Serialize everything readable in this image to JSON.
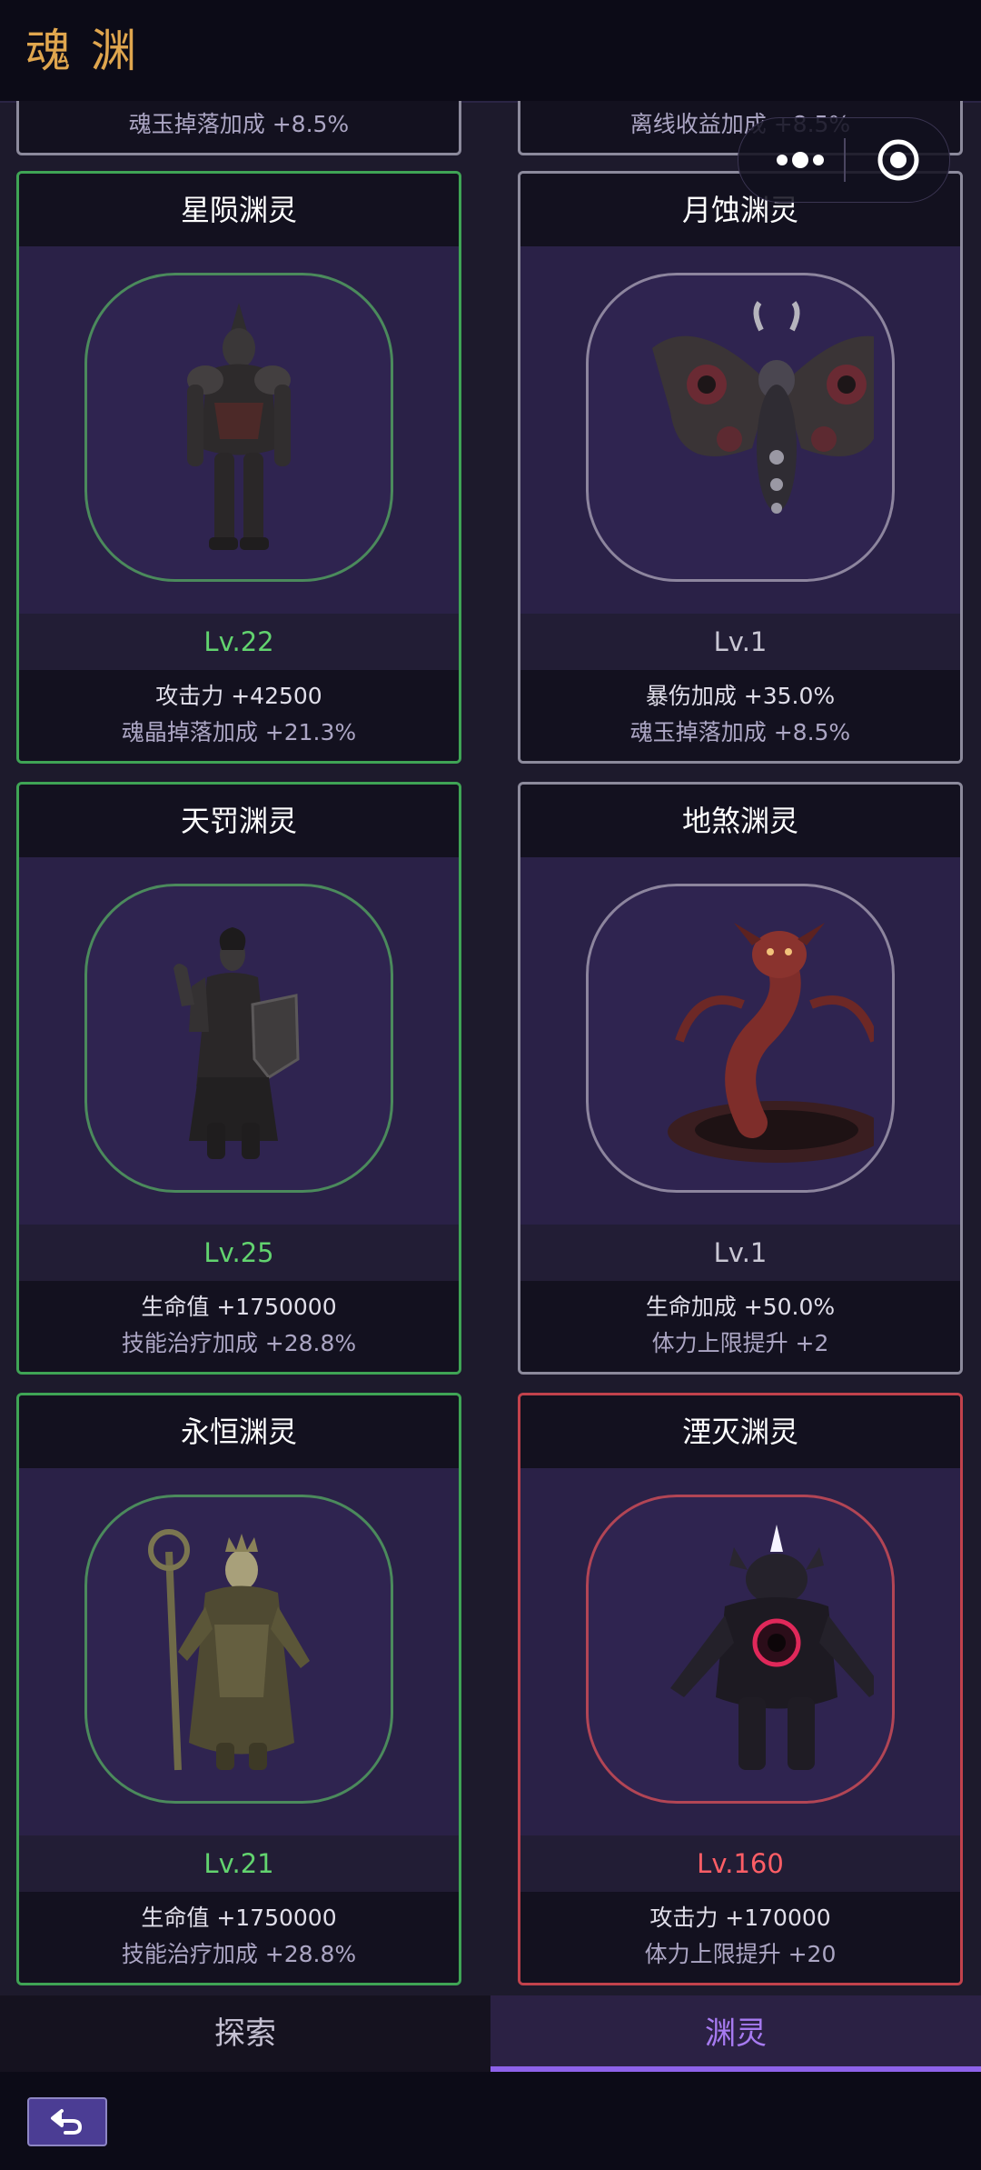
{
  "header": {
    "title": "魂渊"
  },
  "partial_cards": [
    {
      "stat": "魂玉掉落加成 +8.5%"
    },
    {
      "stat": "离线收益加成 +8.5%"
    }
  ],
  "cards": [
    {
      "name": "星陨渊灵",
      "level": "Lv.22",
      "stat1": "攻击力 +42500",
      "stat2": "魂晶掉落加成 +21.3%",
      "tier": "green",
      "icon": "armored-knight-figure"
    },
    {
      "name": "月蚀渊灵",
      "level": "Lv.1",
      "stat1": "暴伤加成 +35.0%",
      "stat2": "魂玉掉落加成 +8.5%",
      "tier": "grey",
      "icon": "moth-creature-figure"
    },
    {
      "name": "天罚渊灵",
      "level": "Lv.25",
      "stat1": "生命值 +1750000",
      "stat2": "技能治疗加成 +28.8%",
      "tier": "green",
      "icon": "dark-paladin-figure"
    },
    {
      "name": "地煞渊灵",
      "level": "Lv.1",
      "stat1": "生命加成 +50.0%",
      "stat2": "体力上限提升 +2",
      "tier": "grey",
      "icon": "serpent-demon-figure"
    },
    {
      "name": "永恒渊灵",
      "level": "Lv.21",
      "stat1": "生命值 +1750000",
      "stat2": "技能治疗加成 +28.8%",
      "tier": "green",
      "icon": "lich-king-figure"
    },
    {
      "name": "湮灭渊灵",
      "level": "Lv.160",
      "stat1": "攻击力 +170000",
      "stat2": "体力上限提升 +20",
      "tier": "red",
      "icon": "void-demon-figure"
    }
  ],
  "tabs": {
    "explore": "探索",
    "abyss": "渊灵"
  },
  "colors": {
    "title": "#e0a64e",
    "tier_green": "#3fa455",
    "tier_grey": "#8c8a9c",
    "tier_red": "#c2424c",
    "active_tab": "#a67af0"
  }
}
